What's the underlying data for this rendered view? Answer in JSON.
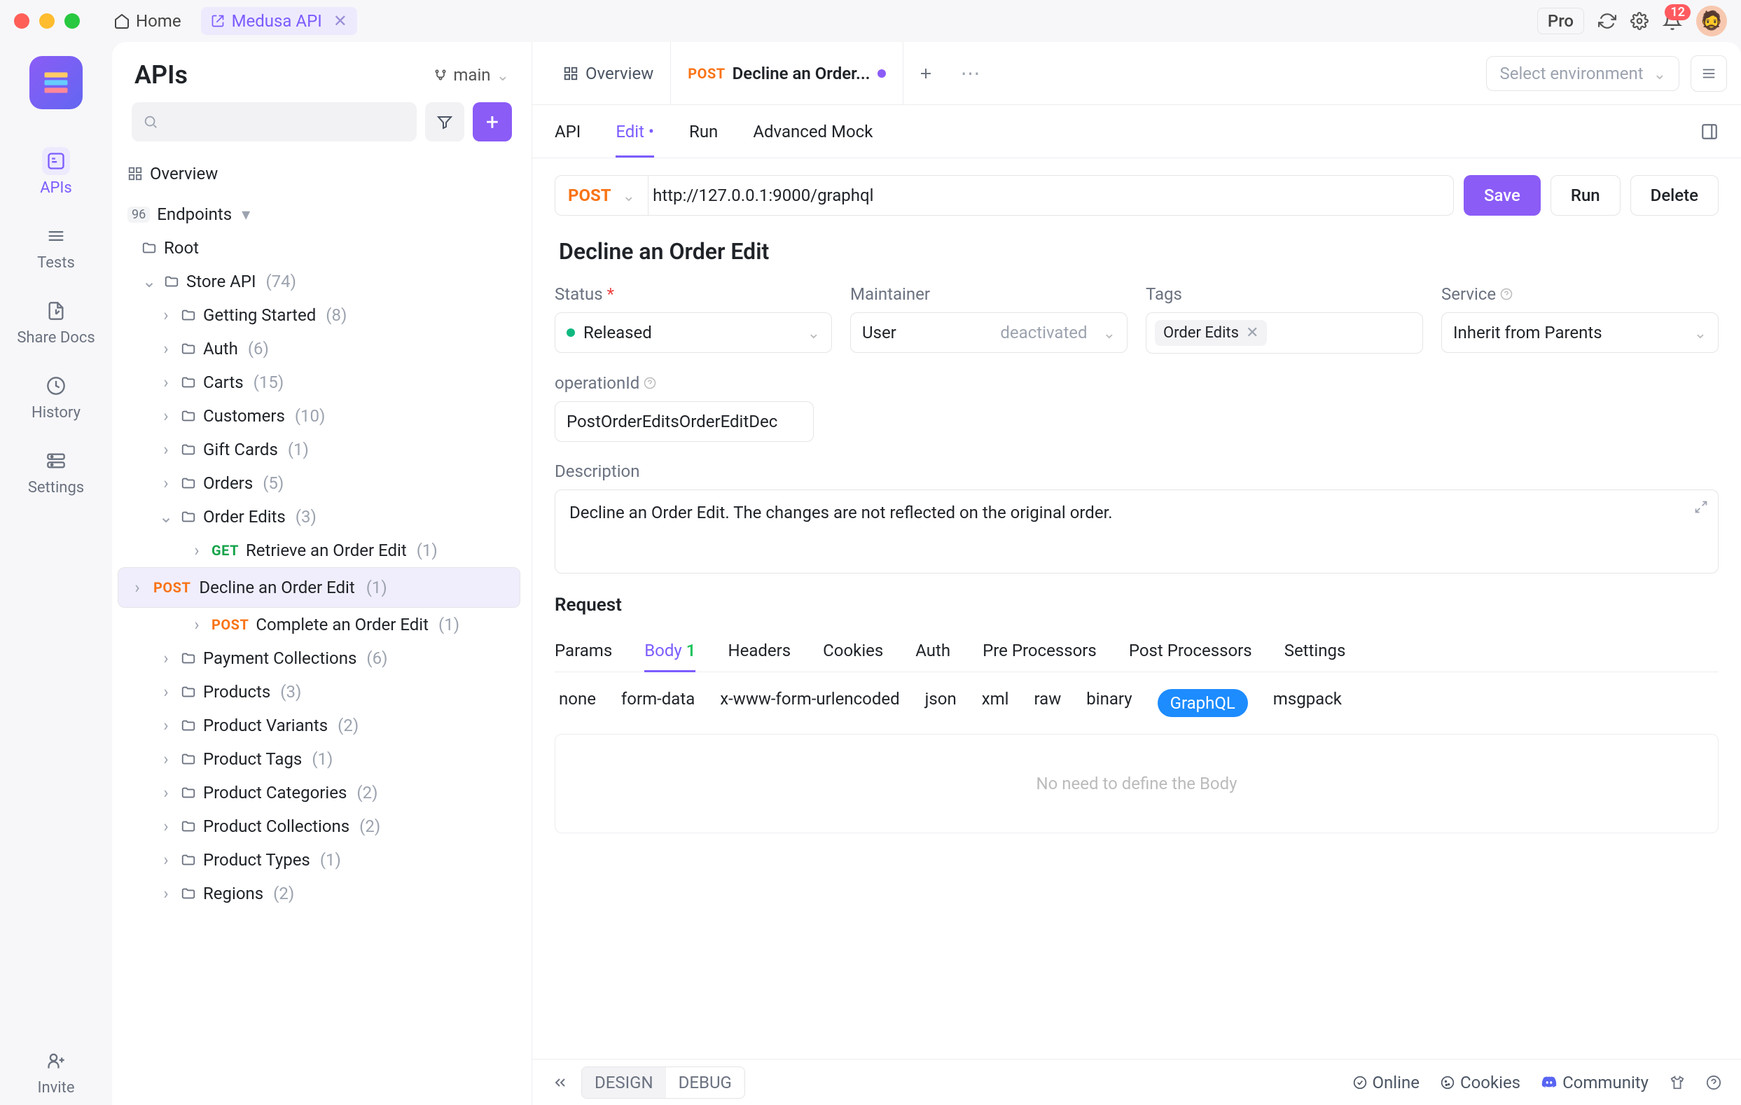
{
  "titlebar": {
    "home": "Home",
    "tab": "Medusa API",
    "pro": "Pro",
    "notif_count": "12"
  },
  "rail": {
    "items": [
      "APIs",
      "Tests",
      "Share Docs",
      "History",
      "Settings"
    ],
    "invite": "Invite"
  },
  "sidebar": {
    "title": "APIs",
    "branch": "main",
    "overview": "Overview",
    "endpoints": "Endpoints",
    "root": "Root",
    "store_api": {
      "label": "Store API",
      "count": "(74)"
    },
    "folders": [
      {
        "label": "Getting Started",
        "count": "(8)"
      },
      {
        "label": "Auth",
        "count": "(6)"
      },
      {
        "label": "Carts",
        "count": "(15)"
      },
      {
        "label": "Customers",
        "count": "(10)"
      },
      {
        "label": "Gift Cards",
        "count": "(1)"
      },
      {
        "label": "Orders",
        "count": "(5)"
      }
    ],
    "order_edits": {
      "label": "Order Edits",
      "count": "(3)"
    },
    "endpoints_list": [
      {
        "method": "GET",
        "label": "Retrieve an Order Edit",
        "count": "(1)"
      },
      {
        "method": "POST",
        "label": "Decline an Order Edit",
        "count": "(1)"
      },
      {
        "method": "POST",
        "label": "Complete an Order Edit",
        "count": "(1)"
      }
    ],
    "folders2": [
      {
        "label": "Payment Collections",
        "count": "(6)"
      },
      {
        "label": "Products",
        "count": "(3)"
      },
      {
        "label": "Product Variants",
        "count": "(2)"
      },
      {
        "label": "Product Tags",
        "count": "(1)"
      },
      {
        "label": "Product Categories",
        "count": "(2)"
      },
      {
        "label": "Product Collections",
        "count": "(2)"
      },
      {
        "label": "Product Types",
        "count": "(1)"
      },
      {
        "label": "Regions",
        "count": "(2)"
      }
    ]
  },
  "doctabs": {
    "overview": "Overview",
    "active": {
      "method": "POST",
      "label": "Decline an Order..."
    },
    "env_placeholder": "Select environment"
  },
  "subtabs": {
    "api": "API",
    "edit": "Edit •",
    "run": "Run",
    "mock": "Advanced Mock"
  },
  "request": {
    "method": "POST",
    "url": "http://127.0.0.1:9000/graphql",
    "save": "Save",
    "run": "Run",
    "delete": "Delete"
  },
  "form": {
    "title": "Decline an Order Edit",
    "status_label": "Status",
    "status_value": "Released",
    "maintainer_label": "Maintainer",
    "maintainer_user": "User",
    "maintainer_state": "deactivated",
    "tags_label": "Tags",
    "tag_value": "Order Edits",
    "service_label": "Service",
    "service_value": "Inherit from Parents",
    "opid_label": "operationId",
    "opid_value": "PostOrderEditsOrderEditDec",
    "desc_label": "Description",
    "desc_value": "Decline an Order Edit. The changes are not reflected on the original order."
  },
  "reqsec": {
    "title": "Request",
    "tabs": [
      "Params",
      "Body",
      "Headers",
      "Cookies",
      "Auth",
      "Pre Processors",
      "Post Processors",
      "Settings"
    ],
    "body_badge": "1",
    "body_types": [
      "none",
      "form-data",
      "x-www-form-urlencoded",
      "json",
      "xml",
      "raw",
      "binary",
      "GraphQL",
      "msgpack"
    ],
    "placeholder": "No need to define the Body"
  },
  "footer": {
    "design": "DESIGN",
    "debug": "DEBUG",
    "online": "Online",
    "cookies": "Cookies",
    "community": "Community"
  }
}
